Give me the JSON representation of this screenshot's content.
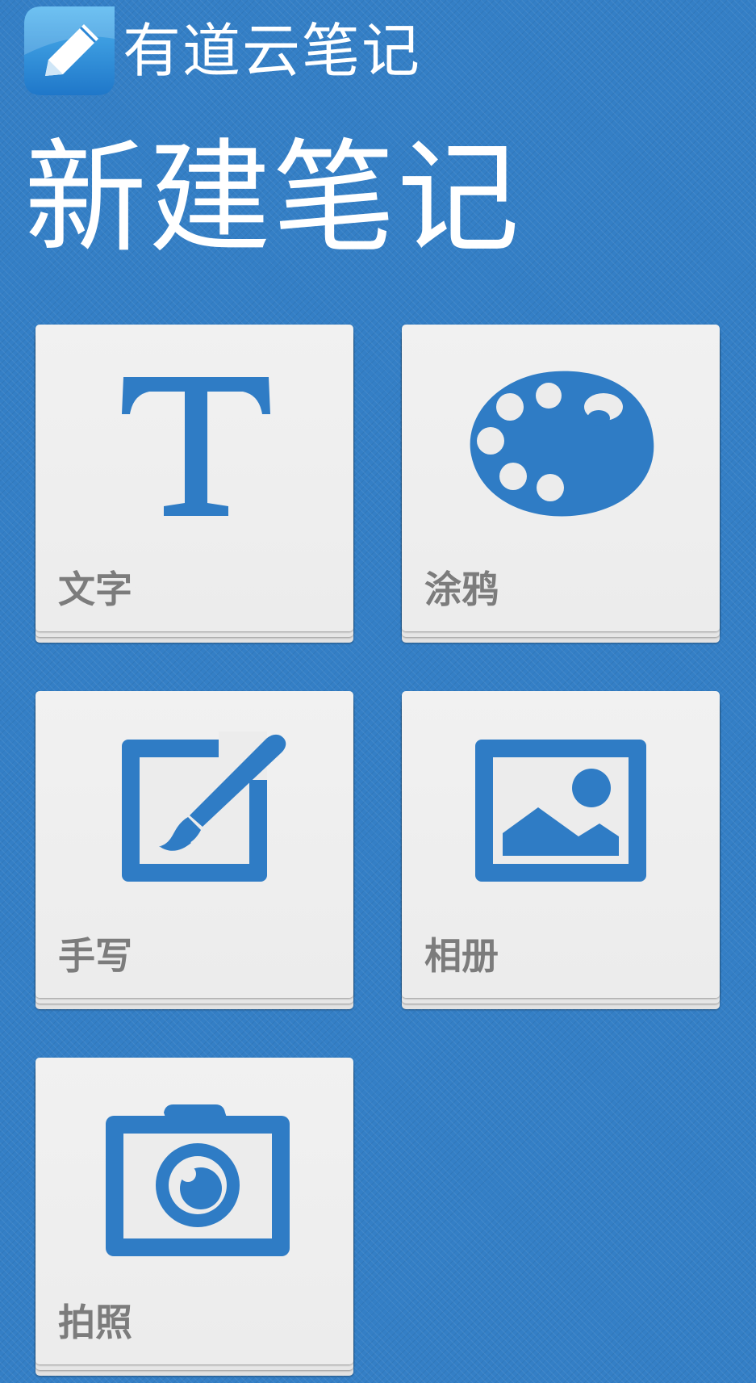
{
  "header": {
    "app_title": "有道云笔记",
    "logo_icon": "youdao-note-logo-icon"
  },
  "page_title": "新建笔记",
  "colors": {
    "background": "#347fc6",
    "icon_blue": "#2f7cc5",
    "tile": "#ececec",
    "label": "#7c7c7c"
  },
  "tiles": [
    {
      "label": "文字",
      "icon": "text-t-icon"
    },
    {
      "label": "涂鸦",
      "icon": "palette-icon"
    },
    {
      "label": "手写",
      "icon": "handwriting-brush-icon"
    },
    {
      "label": "相册",
      "icon": "photo-album-icon"
    },
    {
      "label": "拍照",
      "icon": "camera-icon"
    }
  ]
}
